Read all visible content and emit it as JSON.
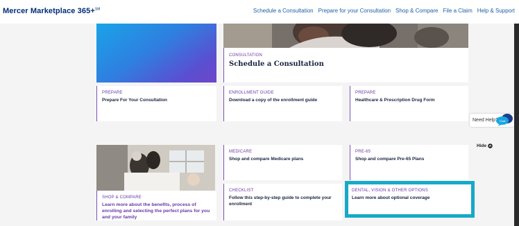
{
  "header": {
    "logo": "Mercer Marketplace 365+",
    "logo_mark": "SM",
    "nav": [
      "Schedule a Consultation",
      "Prepare for your Consultation",
      "Shop & Compare",
      "File a Claim",
      "Help & Support"
    ]
  },
  "cards": {
    "consultation": {
      "tag": "CONSULTATION",
      "title": "Schedule a Consultation"
    },
    "prepare1": {
      "tag": "PREPARE",
      "title": "Prepare For Your Consultation"
    },
    "guide": {
      "tag": "ENROLLMENT GUIDE",
      "title": "Download a copy of the enrollment guide"
    },
    "prepare2": {
      "tag": "PREPARE",
      "title": "Healthcare & Prescription Drug Form"
    },
    "medicare": {
      "tag": "MEDICARE",
      "title": "Shop and compare Medicare plans"
    },
    "pre65": {
      "tag": "PRE-65",
      "title": "Shop and compare Pre-65 Plans"
    },
    "shop": {
      "tag": "SHOP & COMPARE",
      "title": "Learn more about the benefits, process of enrolling and selecting the perfect plans for you and your family"
    },
    "checklist": {
      "tag": "CHECKLIST",
      "title": "Follow this step-by-step guide to complete your enrollment"
    },
    "dental": {
      "tag": "DENTAL, VISION & OTHER OPTIONS",
      "title": "Learn more about optional coverage"
    }
  },
  "help": {
    "label": "Need Help?",
    "chat_badge": "Chat"
  },
  "hide": {
    "label": "Hide"
  },
  "colors": {
    "brand": "#002c77",
    "link": "#1d5fa8",
    "accent": "#6a36a6",
    "highlight": "#17a9c8"
  }
}
